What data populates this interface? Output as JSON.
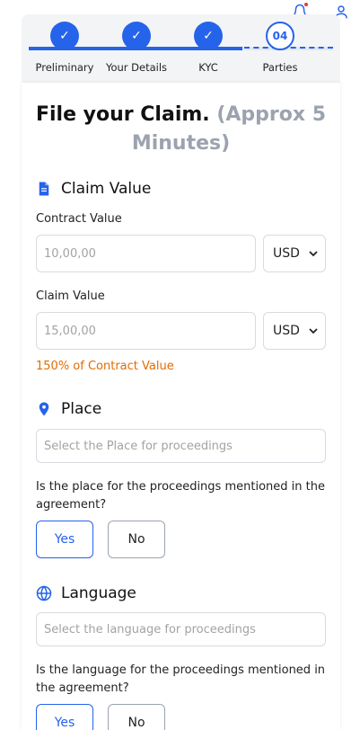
{
  "header": {
    "bell_icon": "bell-icon",
    "user_icon": "user-icon"
  },
  "stepper": {
    "steps": [
      {
        "label": "Preliminary",
        "state": "done",
        "marker": "✓"
      },
      {
        "label": "Your Details",
        "state": "done",
        "marker": "✓"
      },
      {
        "label": "KYC",
        "state": "done",
        "marker": "✓"
      },
      {
        "label": "Parties",
        "state": "current",
        "marker": "04"
      }
    ],
    "accent": "#2563eb"
  },
  "form": {
    "title_main": "File your Claim.",
    "title_sub": "(Approx 5 Minutes)",
    "claim_value": {
      "heading": "Claim Value",
      "contract_label": "Contract Value",
      "contract_placeholder": "10,00,00",
      "contract_currency": "USD",
      "claim_label": "Claim Value",
      "claim_placeholder": "15,00,00",
      "claim_currency": "USD",
      "hint": "150% of Contract Value"
    },
    "place": {
      "heading": "Place",
      "placeholder": "Select the Place for proceedings",
      "question": "Is the place for the proceedings mentioned in the agreement?",
      "yes": "Yes",
      "no": "No"
    },
    "language": {
      "heading": "Language",
      "placeholder": "Select the language for proceedings",
      "question": "Is the language for the proceedings mentioned in the agreement?",
      "yes": "Yes",
      "no": "No"
    }
  },
  "colors": {
    "primary": "#2563eb",
    "hint": "#e36b00",
    "notification": "#e53935"
  }
}
